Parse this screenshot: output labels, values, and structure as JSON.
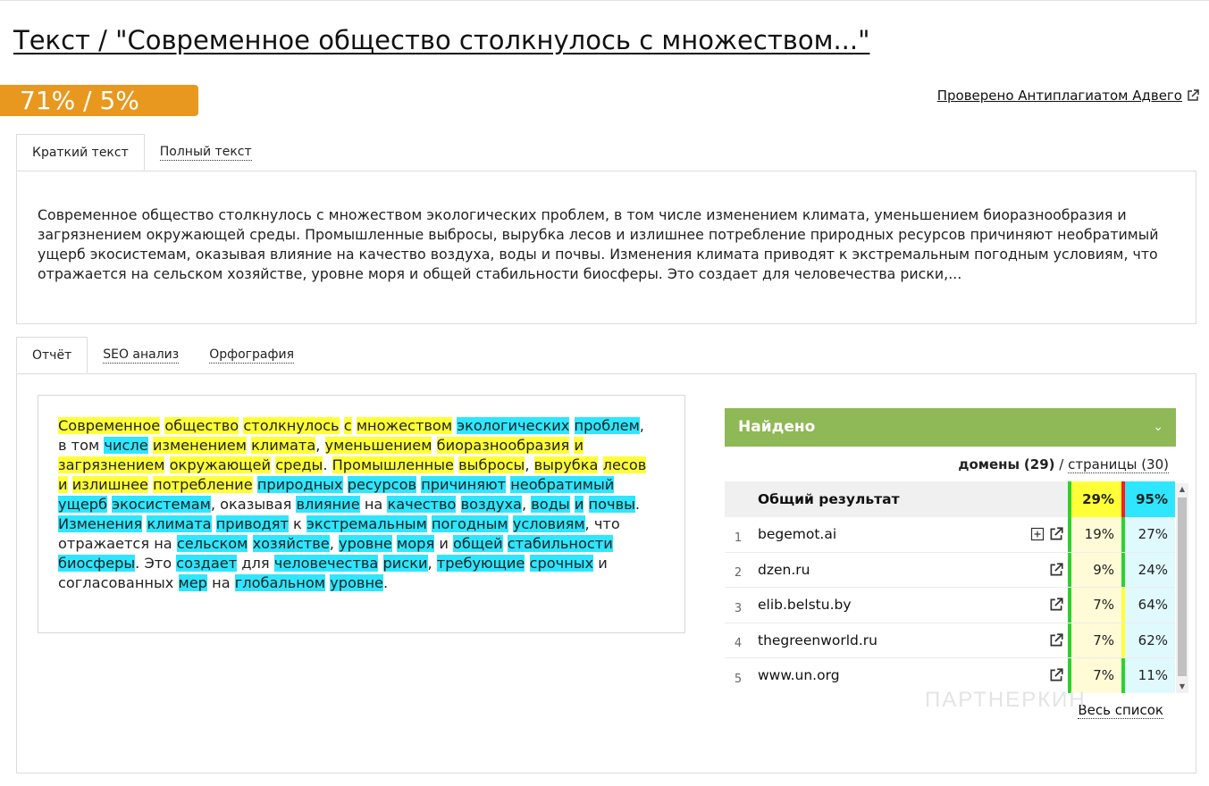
{
  "page": {
    "title": "Текст / \"Современное общество столкнулось с множеством...\"",
    "score": "71% / 5%",
    "checked_by": "Проверено Антиплагиатом Адвего",
    "colors": {
      "score_badge": "#e8981f",
      "found_header": "#8fb856",
      "highlight_yellow": "#ffff37",
      "highlight_cyan": "#2ee6ff"
    }
  },
  "text_tabs": [
    {
      "label": "Краткий текст",
      "active": true
    },
    {
      "label": "Полный текст",
      "active": false
    }
  ],
  "short_text": "Современное общество столкнулось с множеством экологических проблем, в том числе изменением климата, уменьшением биоразнообразия и загрязнением окружающей среды. Промышленные выбросы, вырубка лесов и излишнее потребление природных ресурсов причиняют необратимый ущерб экосистемам, оказывая влияние на качество воздуха, воды и почвы. Изменения климата приводят к экстремальным погодным условиям, что отражается на сельском хозяйстве, уровне моря и общей стабильности биосферы. Это создает для человечества риски,...",
  "report_tabs": [
    {
      "label": "Отчёт",
      "active": true
    },
    {
      "label": "SEO анализ",
      "active": false
    },
    {
      "label": "Орфография",
      "active": false
    }
  ],
  "highlighted_text": [
    [
      "Современное",
      "y"
    ],
    [
      " ",
      ""
    ],
    [
      "общество",
      "y"
    ],
    [
      " ",
      ""
    ],
    [
      "столкнулось",
      "y"
    ],
    [
      " ",
      ""
    ],
    [
      "с",
      "y"
    ],
    [
      " ",
      ""
    ],
    [
      "множеством",
      "y"
    ],
    [
      " ",
      ""
    ],
    [
      "экологических",
      "c"
    ],
    [
      " ",
      ""
    ],
    [
      "проблем",
      "c"
    ],
    [
      ", в том ",
      ""
    ],
    [
      "числе",
      "c"
    ],
    [
      " ",
      ""
    ],
    [
      "изменением",
      "y"
    ],
    [
      " ",
      ""
    ],
    [
      "климата",
      "y"
    ],
    [
      ", ",
      ""
    ],
    [
      "уменьшением",
      "y"
    ],
    [
      " ",
      ""
    ],
    [
      "биоразнообразия",
      "y"
    ],
    [
      " ",
      ""
    ],
    [
      "и",
      "y"
    ],
    [
      " ",
      ""
    ],
    [
      "загрязнением",
      "y"
    ],
    [
      " ",
      ""
    ],
    [
      "окружающей",
      "y"
    ],
    [
      " ",
      ""
    ],
    [
      "среды",
      "y"
    ],
    [
      ". ",
      ""
    ],
    [
      "Промышленные",
      "y"
    ],
    [
      " ",
      ""
    ],
    [
      "выбросы",
      "y"
    ],
    [
      ", ",
      ""
    ],
    [
      "вырубка",
      "y"
    ],
    [
      " ",
      ""
    ],
    [
      "лесов",
      "y"
    ],
    [
      " ",
      ""
    ],
    [
      "и",
      "y"
    ],
    [
      " ",
      ""
    ],
    [
      "излишнее",
      "y"
    ],
    [
      " ",
      ""
    ],
    [
      "потребление",
      "y"
    ],
    [
      " ",
      ""
    ],
    [
      "природных",
      "c"
    ],
    [
      " ",
      ""
    ],
    [
      "ресурсов",
      "c"
    ],
    [
      " ",
      ""
    ],
    [
      "причиняют",
      "c"
    ],
    [
      " ",
      ""
    ],
    [
      "необратимый",
      "c"
    ],
    [
      " ",
      ""
    ],
    [
      "ущерб",
      "c"
    ],
    [
      " ",
      ""
    ],
    [
      "экосистемам",
      "c"
    ],
    [
      ", оказывая ",
      ""
    ],
    [
      "влияние",
      "c"
    ],
    [
      " на ",
      ""
    ],
    [
      "качество",
      "c"
    ],
    [
      " ",
      ""
    ],
    [
      "воздуха",
      "c"
    ],
    [
      ", ",
      ""
    ],
    [
      "воды",
      "c"
    ],
    [
      " ",
      ""
    ],
    [
      "и",
      "c"
    ],
    [
      " ",
      ""
    ],
    [
      "почвы",
      "c"
    ],
    [
      ". ",
      ""
    ],
    [
      "Изменения",
      "c"
    ],
    [
      " ",
      ""
    ],
    [
      "климата",
      "c"
    ],
    [
      " ",
      ""
    ],
    [
      "приводят",
      "c"
    ],
    [
      " к ",
      ""
    ],
    [
      "экстремальным",
      "c"
    ],
    [
      " ",
      ""
    ],
    [
      "погодным",
      "c"
    ],
    [
      " ",
      ""
    ],
    [
      "условиям",
      "c"
    ],
    [
      ", что отражается на ",
      ""
    ],
    [
      "сельском",
      "c"
    ],
    [
      " ",
      ""
    ],
    [
      "хозяйстве",
      "c"
    ],
    [
      ", ",
      ""
    ],
    [
      "уровне",
      "c"
    ],
    [
      " ",
      ""
    ],
    [
      "моря",
      "c"
    ],
    [
      " и ",
      ""
    ],
    [
      "общей",
      "c"
    ],
    [
      " ",
      ""
    ],
    [
      "стабильности",
      "c"
    ],
    [
      " ",
      ""
    ],
    [
      "биосферы",
      "c"
    ],
    [
      ". Это ",
      ""
    ],
    [
      "создает",
      "c"
    ],
    [
      " ",
      ""
    ],
    [
      "для ",
      ""
    ],
    [
      "человечества",
      "c"
    ],
    [
      " ",
      ""
    ],
    [
      "риски",
      "c"
    ],
    [
      ", ",
      ""
    ],
    [
      "требующие",
      "c"
    ],
    [
      " ",
      ""
    ],
    [
      "срочных",
      "c"
    ],
    [
      " и согласованных ",
      ""
    ],
    [
      "мер",
      "c"
    ],
    [
      " на ",
      ""
    ],
    [
      "глобальном",
      "c"
    ],
    [
      " ",
      ""
    ],
    [
      "уровне",
      "c"
    ],
    [
      ".",
      ""
    ]
  ],
  "found": {
    "header": "Найдено",
    "domains_label": "домены",
    "domains_count": "(29)",
    "separator": "/",
    "pages_label": "страницы (30)",
    "overall_label": "Общий результат",
    "overall_a": "29%",
    "overall_b": "95%",
    "rows": [
      {
        "num": "1",
        "domain": "begemot.ai",
        "a": "19%",
        "b": "27%",
        "plus": true,
        "warn": false
      },
      {
        "num": "2",
        "domain": "dzen.ru",
        "a": "9%",
        "b": "24%",
        "plus": false,
        "warn": false
      },
      {
        "num": "3",
        "domain": "elib.belstu.by",
        "a": "7%",
        "b": "64%",
        "plus": false,
        "warn": true
      },
      {
        "num": "4",
        "domain": "thegreenworld.ru",
        "a": "7%",
        "b": "62%",
        "plus": false,
        "warn": true
      },
      {
        "num": "5",
        "domain": "www.un.org",
        "a": "7%",
        "b": "11%",
        "plus": false,
        "warn": false
      }
    ],
    "full_list": "Весь список"
  },
  "watermark": "ПАРТНЕРКИН",
  "icons": {
    "external": "external-link-icon",
    "expand": "plus-square-icon",
    "chevron": "chevron-down-icon"
  }
}
